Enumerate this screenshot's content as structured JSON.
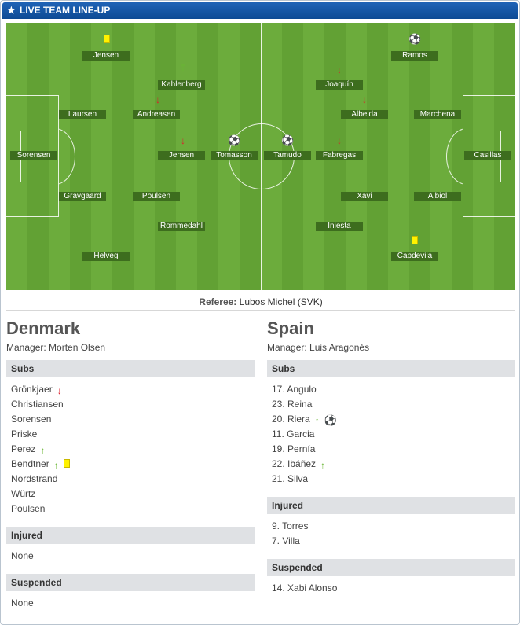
{
  "title": "LIVE TEAM LINE-UP",
  "title_icon": "star-icon",
  "colors": {
    "header": "#1452a0",
    "pitch": "#6cac3c",
    "label_bg": "#3d6d1e",
    "sub_off": "#dd1f2c",
    "sub_on": "#6ab634",
    "card": "#fff200"
  },
  "pitch": {
    "home_players": [
      {
        "name": "Jensen",
        "icons": [
          "yellow-card-icon"
        ]
      },
      {
        "name": "Kahlenberg",
        "icons": [
          "sub-on-arrow-icon"
        ]
      },
      {
        "name": "Laursen",
        "icons": []
      },
      {
        "name": "Andreasen",
        "icons": [
          "sub-off-arrow-icon"
        ]
      },
      {
        "name": "Sorensen",
        "icons": []
      },
      {
        "name": "Jensen",
        "icons": [
          "sub-off-arrow-icon"
        ]
      },
      {
        "name": "Tomasson",
        "icons": [
          "goal-ball-icon"
        ]
      },
      {
        "name": "Gravgaard",
        "icons": []
      },
      {
        "name": "Poulsen",
        "icons": []
      },
      {
        "name": "Rommedahl",
        "icons": []
      },
      {
        "name": "Helveg",
        "icons": []
      }
    ],
    "away_players": [
      {
        "name": "Ramos",
        "icons": [
          "goal-ball-icon"
        ]
      },
      {
        "name": "Joaquín",
        "icons": [
          "sub-off-arrow-icon"
        ]
      },
      {
        "name": "Albelda",
        "icons": [
          "sub-off-arrow-icon"
        ]
      },
      {
        "name": "Marchena",
        "icons": []
      },
      {
        "name": "Tamudo",
        "icons": [
          "goal-ball-icon"
        ]
      },
      {
        "name": "Fabregas",
        "icons": [
          "sub-off-arrow-icon"
        ]
      },
      {
        "name": "Casillas",
        "icons": []
      },
      {
        "name": "Xavi",
        "icons": []
      },
      {
        "name": "Albiol",
        "icons": []
      },
      {
        "name": "Iniesta",
        "icons": []
      },
      {
        "name": "Capdevila",
        "icons": [
          "yellow-card-icon"
        ]
      }
    ]
  },
  "referee": {
    "label": "Referee:",
    "name": "Lubos Michel (SVK)"
  },
  "home": {
    "team": "Denmark",
    "manager": "Manager: Morten Olsen",
    "subs_title": "Subs",
    "subs": [
      {
        "name": "Grönkjaer",
        "icons": [
          "sub-off-arrow-icon"
        ]
      },
      {
        "name": "Christiansen",
        "icons": []
      },
      {
        "name": "Sorensen",
        "icons": []
      },
      {
        "name": "Priske",
        "icons": []
      },
      {
        "name": "Perez",
        "icons": [
          "sub-on-arrow-icon"
        ]
      },
      {
        "name": "Bendtner",
        "icons": [
          "sub-on-arrow-icon",
          "yellow-card-icon"
        ]
      },
      {
        "name": "Nordstrand",
        "icons": []
      },
      {
        "name": "Würtz",
        "icons": []
      },
      {
        "name": "Poulsen",
        "icons": []
      }
    ],
    "injured_title": "Injured",
    "injured": [
      "None"
    ],
    "suspended_title": "Suspended",
    "suspended": [
      "None"
    ]
  },
  "away": {
    "team": "Spain",
    "manager": "Manager: Luis Aragonés",
    "subs_title": "Subs",
    "subs": [
      {
        "name": "17. Angulo",
        "icons": []
      },
      {
        "name": "23. Reina",
        "icons": []
      },
      {
        "name": "20. Riera",
        "icons": [
          "sub-on-arrow-icon",
          "goal-ball-icon"
        ]
      },
      {
        "name": "11. Garcia",
        "icons": []
      },
      {
        "name": "19. Pernía",
        "icons": []
      },
      {
        "name": "22. Ibáñez",
        "icons": [
          "sub-on-arrow-icon"
        ]
      },
      {
        "name": "21. Silva",
        "icons": []
      }
    ],
    "injured_title": "Injured",
    "injured": [
      "9. Torres",
      "7. Villa"
    ],
    "suspended_title": "Suspended",
    "suspended": [
      "14. Xabi Alonso"
    ]
  }
}
